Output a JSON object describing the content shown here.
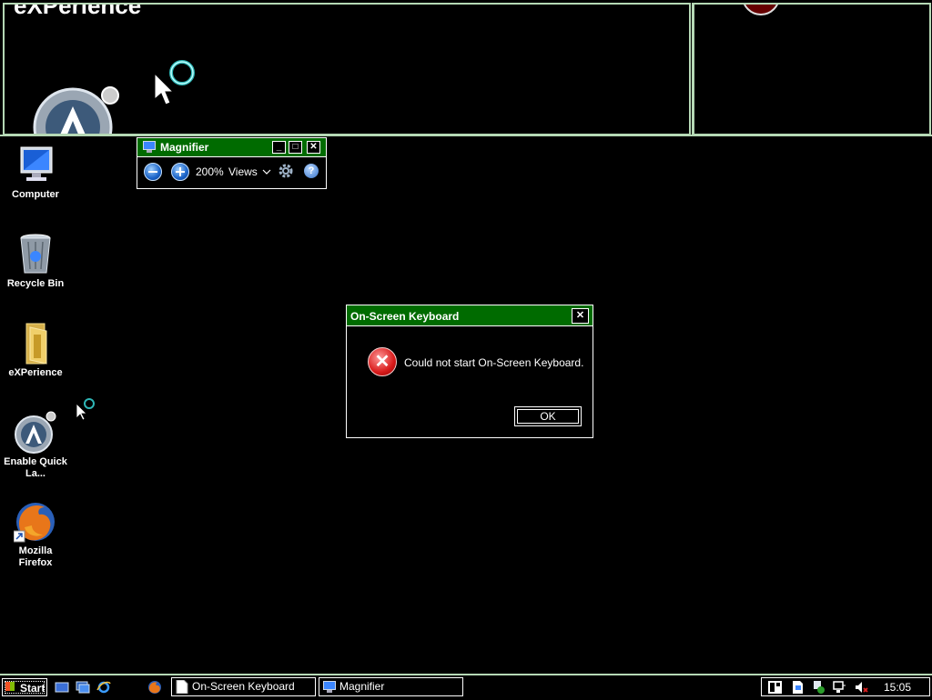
{
  "magnifier_view": {
    "zoom_text": "eXPerience"
  },
  "desktop_icons": [
    {
      "label": "Computer",
      "icon": "computer-icon"
    },
    {
      "label": "Recycle Bin",
      "icon": "recycle-bin-icon"
    },
    {
      "label": "eXPerience",
      "icon": "folder-icon"
    },
    {
      "label": "Enable Quick La...",
      "icon": "aero-icon"
    },
    {
      "label": "Mozilla Firefox",
      "icon": "firefox-icon"
    }
  ],
  "magnifier_window": {
    "title": "Magnifier",
    "zoom_level": "200%",
    "views_label": "Views",
    "minimize": "_",
    "maximize": "□",
    "close": "✕",
    "help": "?"
  },
  "dialog": {
    "title": "On-Screen Keyboard",
    "message": "Could not start On-Screen Keyboard.",
    "ok_label": "OK",
    "close": "✕"
  },
  "taskbar": {
    "start_label": "Start",
    "buttons": [
      {
        "label": "On-Screen Keyboard",
        "icon": "document-icon"
      },
      {
        "label": "Magnifier",
        "icon": "magnifier-icon"
      }
    ],
    "clock": "15:05"
  },
  "colors": {
    "title_bar": "#006b00",
    "border": "#b5d8b5",
    "background": "#000000"
  }
}
